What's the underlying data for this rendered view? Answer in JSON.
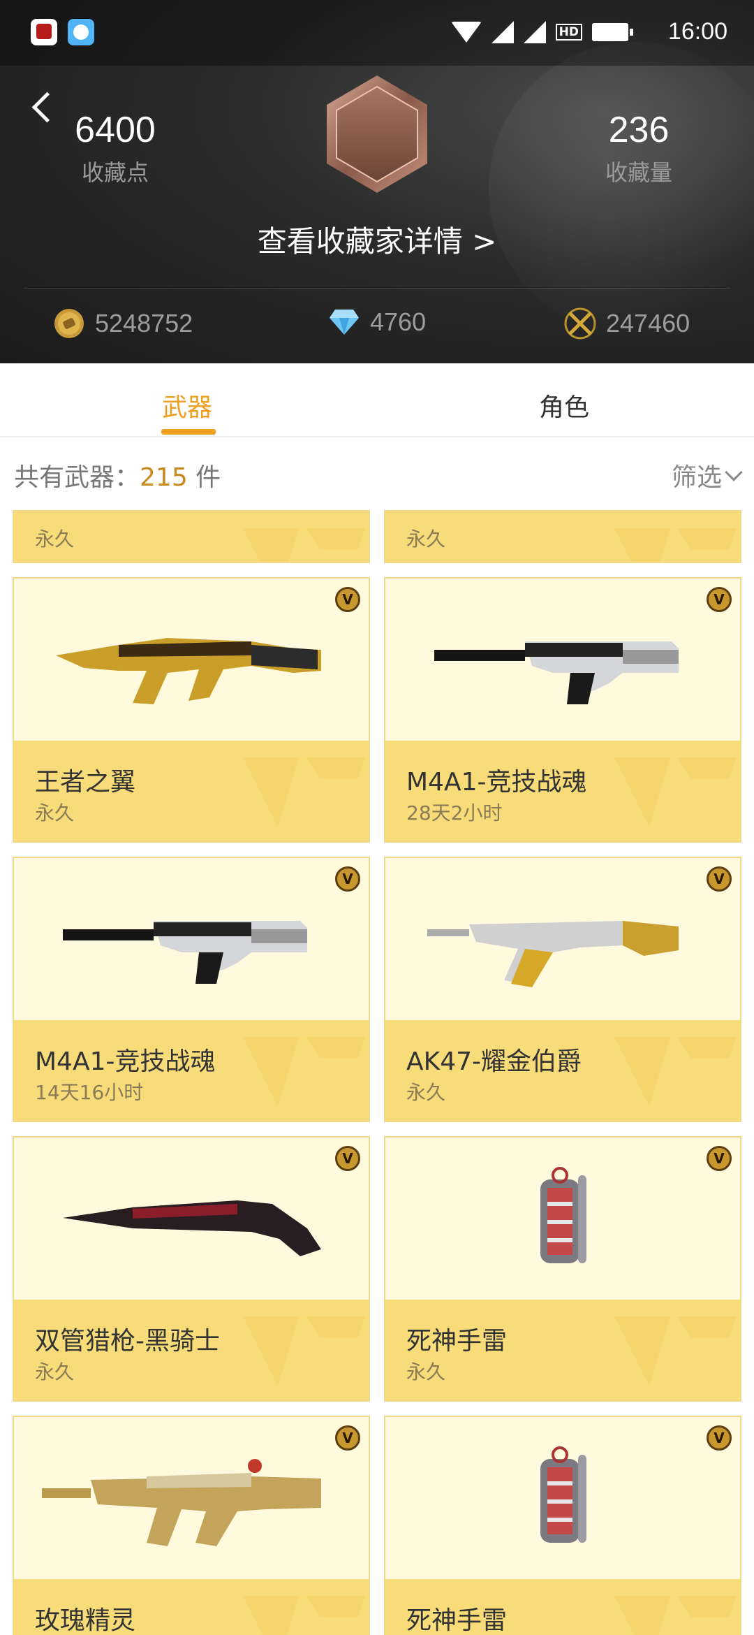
{
  "status_bar": {
    "time": "16:00",
    "network_label": "HD"
  },
  "header": {
    "collection_points_value": "6400",
    "collection_points_label": "收藏点",
    "collection_count_value": "236",
    "collection_count_label": "收藏量",
    "detail_link": "查看收藏家详情 >",
    "currencies": [
      {
        "icon": "gold-coin-icon",
        "value": "5248752"
      },
      {
        "icon": "diamond-icon",
        "value": "4760"
      },
      {
        "icon": "crossed-swords-icon",
        "value": "247460"
      }
    ]
  },
  "tabs": [
    {
      "label": "武器",
      "active": true
    },
    {
      "label": "角色",
      "active": false
    }
  ],
  "summary": {
    "prefix": "共有武器：",
    "count": "215",
    "unit": " 件",
    "filter_label": "筛选"
  },
  "items": [
    {
      "name": "",
      "duration": "永久"
    },
    {
      "name": "",
      "duration": "永久"
    },
    {
      "name": "王者之翼",
      "duration": "永久"
    },
    {
      "name": "M4A1-竞技战魂",
      "duration": "28天2小时"
    },
    {
      "name": "M4A1-竞技战魂",
      "duration": "14天16小时"
    },
    {
      "name": "AK47-耀金伯爵",
      "duration": "永久"
    },
    {
      "name": "双管猎枪-黑骑士",
      "duration": "永久"
    },
    {
      "name": "死神手雷",
      "duration": "永久"
    },
    {
      "name": "玫瑰精灵",
      "duration": ""
    },
    {
      "name": "死神手雷",
      "duration": ""
    }
  ],
  "colors": {
    "accent": "#f0a020",
    "card_bg": "#fff8dc",
    "card_info": "#f8dc7a"
  }
}
